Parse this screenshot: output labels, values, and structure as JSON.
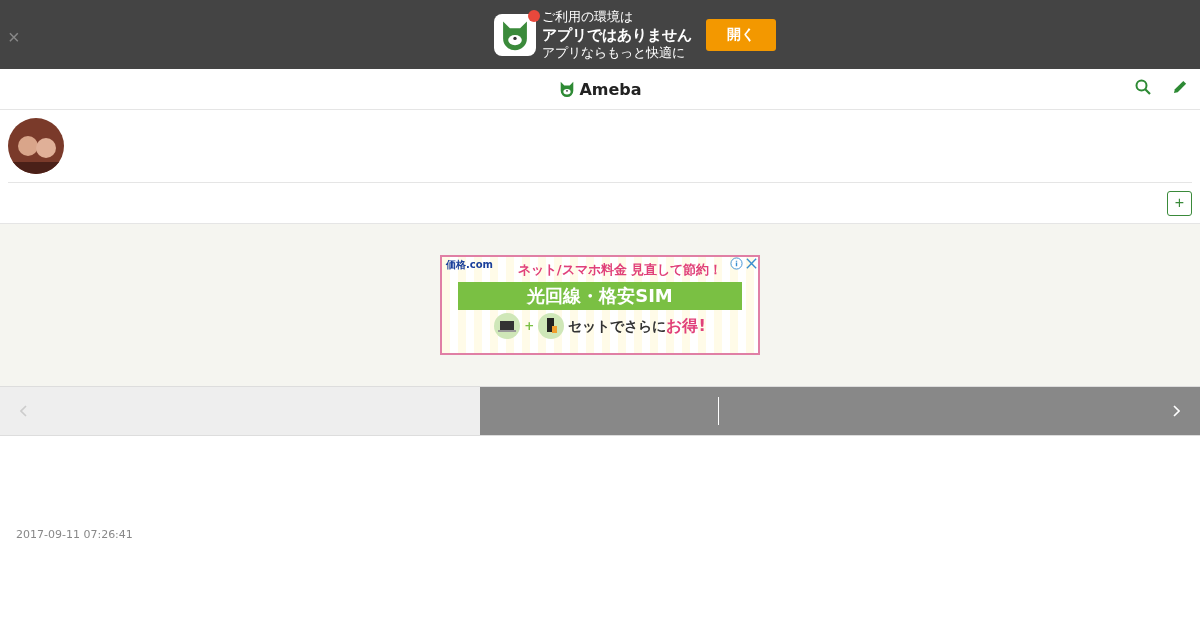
{
  "app_banner": {
    "close": "×",
    "lines": [
      "ご利用の環境は",
      "アプリではありません",
      "アプリならもっと快適に"
    ],
    "button": "開く",
    "notification": true
  },
  "header": {
    "logo": "Ameba"
  },
  "profile": {
    "follow_button": "+"
  },
  "ad": {
    "brand": "価格.com",
    "headline": "ネット/スマホ料金 見直して節約！",
    "ribbon": "光回線・格安SIM",
    "tagline": "セットでさらに",
    "tagline_emphasis": "お得!",
    "plus": "+"
  },
  "pager": [
    {
      "kind": "prev",
      "disabled": true
    },
    {
      "kind": "next",
      "disabled": false
    }
  ],
  "entry": {
    "date": "2017-09-11 07:26:41"
  }
}
